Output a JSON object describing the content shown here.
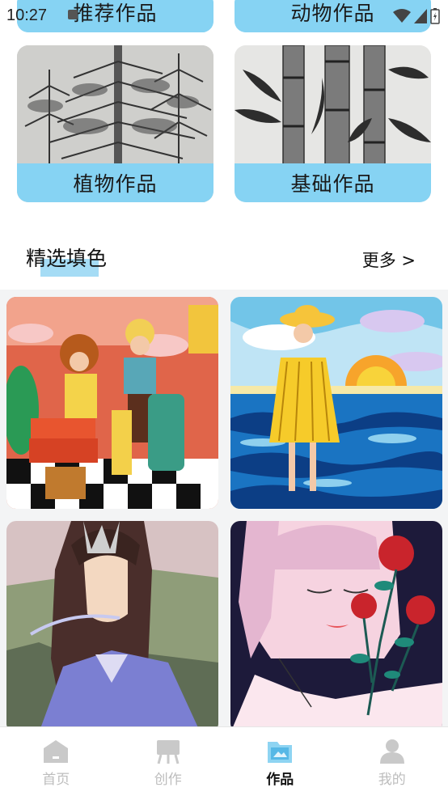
{
  "status_bar": {
    "time": "10:27"
  },
  "categories": [
    {
      "label": "推荐作品"
    },
    {
      "label": "动物作品"
    },
    {
      "label": "植物作品"
    },
    {
      "label": "基础作品"
    }
  ],
  "section": {
    "title": "精选填色",
    "more": "更多 >"
  },
  "nav": {
    "items": [
      {
        "label": "首页",
        "icon": "home-icon"
      },
      {
        "label": "创作",
        "icon": "easel-icon"
      },
      {
        "label": "作品",
        "icon": "gallery-icon"
      },
      {
        "label": "我的",
        "icon": "profile-icon"
      }
    ],
    "active_index": 2
  },
  "colors": {
    "accent": "#86d3f3",
    "nav_inactive": "#bdbdbd",
    "nav_active": "#111111"
  }
}
